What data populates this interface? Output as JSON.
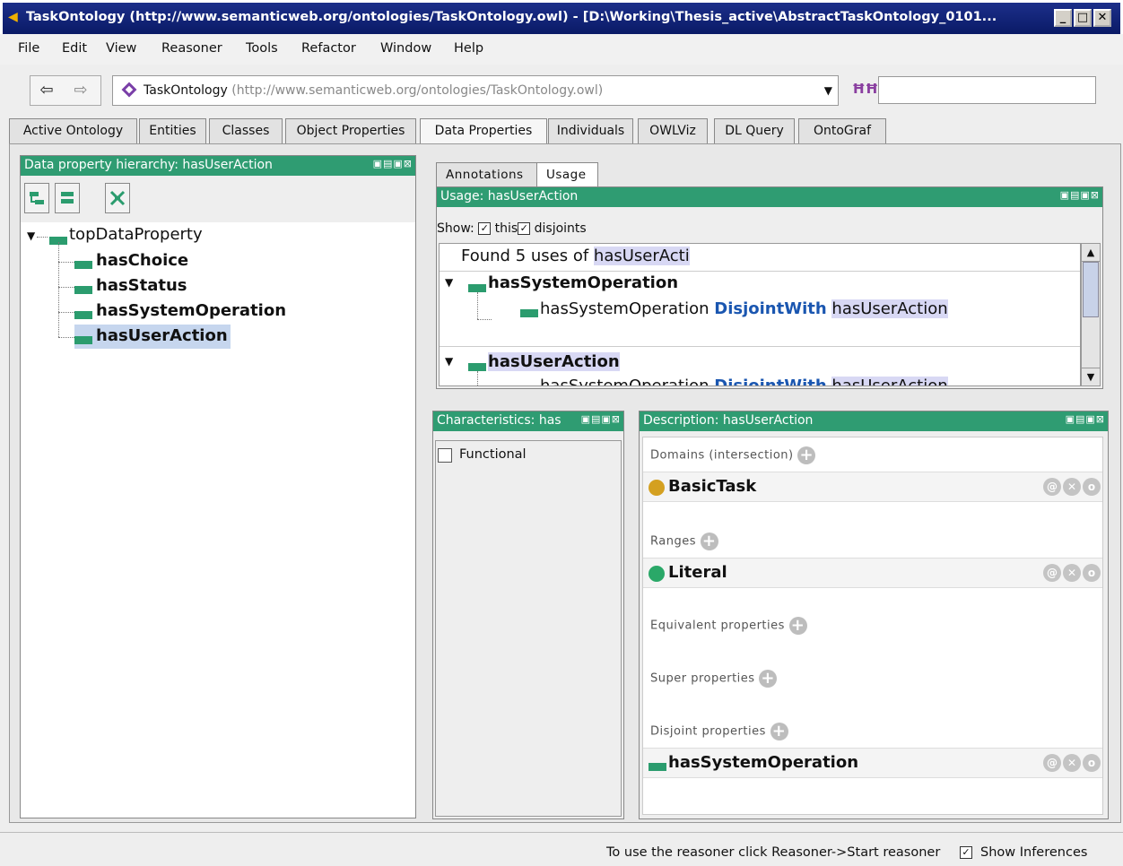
{
  "window": {
    "title": "TaskOntology (http://www.semanticweb.org/ontologies/TaskOntology.owl) - [D:\\Working\\Thesis_active\\AbstractTaskOntology_0101...",
    "minimize": "_",
    "maximize": "□",
    "close": "✕"
  },
  "menu": [
    "File",
    "Edit",
    "View",
    "Reasoner",
    "Tools",
    "Refactor",
    "Window",
    "Help"
  ],
  "nav": {
    "back": "⇦",
    "forward": "⇨"
  },
  "ontology_selector": {
    "name": "TaskOntology",
    "iri": "(http://www.semanticweb.org/ontologies/TaskOntology.owl)",
    "arrow": "▼"
  },
  "search": {
    "icon": "binoculars-icon",
    "glyph": "ĦĦ",
    "value": ""
  },
  "tabs": [
    "Active Ontology",
    "Entities",
    "Classes",
    "Object Properties",
    "Data Properties",
    "Individuals",
    "OWLViz",
    "DL Query",
    "OntoGraf"
  ],
  "active_tab": "Data Properties",
  "hierarchy": {
    "header": "Data property hierarchy: hasUserAction",
    "controls": "▣▤▣⊠",
    "tools": [
      "add-sub-property-icon",
      "add-sibling-property-icon",
      "delete-property-icon"
    ],
    "root": "topDataProperty",
    "root_toggle": "▼",
    "children": [
      "hasChoice",
      "hasStatus",
      "hasSystemOperation",
      "hasUserAction"
    ],
    "selected": "hasUserAction"
  },
  "usage": {
    "tabs": [
      "Annotations",
      "Usage"
    ],
    "active_tab": "Usage",
    "header": "Usage: hasUserAction",
    "controls": "▣▤▣⊠",
    "show_label": "Show:",
    "this_label": "this",
    "disjoints_label": "disjoints",
    "this_checked": "✓",
    "disjoints_checked": "✓",
    "found_prefix": "Found 5 uses of ",
    "found_term": "hasUserActi",
    "groups": [
      {
        "toggle": "▼",
        "name": "hasSystemOperation",
        "axiom_subject": "hasSystemOperation",
        "axiom_keyword": "DisjointWith",
        "axiom_object": "hasUserAction"
      },
      {
        "toggle": "▼",
        "name": "hasUserAction",
        "axiom_subject": "hasSystemOperation",
        "axiom_keyword": "DisjointWith",
        "axiom_object": "hasUserAction"
      }
    ],
    "scroll_up": "▲",
    "scroll_down": "▼"
  },
  "characteristics": {
    "header": "Characteristics: has",
    "controls": "▣▤▣⊠",
    "functional_label": "Functional",
    "functional_checked": false
  },
  "description": {
    "header": "Description: hasUserAction",
    "controls": "▣▤▣⊠",
    "domains_label": "Domains (intersection)",
    "domain_value": "BasicTask",
    "ranges_label": "Ranges",
    "range_value": "Literal",
    "equivalent_label": "Equivalent properties",
    "super_label": "Super properties",
    "disjoint_label": "Disjoint properties",
    "disjoint_value": "hasSystemOperation",
    "row_buttons": [
      "@",
      "✕",
      "o"
    ],
    "plus": "+",
    "colors": {
      "class_dot": "#d4a020",
      "datatype_dot": "#2aa868",
      "property_bar": "#2b9c6e"
    }
  },
  "status": {
    "message": "To use the reasoner click Reasoner->Start reasoner",
    "show_inferences_label": "Show Inferences",
    "show_inferences_checked": "✓"
  },
  "colors": {
    "header_green": "#2f9c72",
    "keyword_blue": "#1a56b0",
    "highlight": "#d8d8f4"
  }
}
